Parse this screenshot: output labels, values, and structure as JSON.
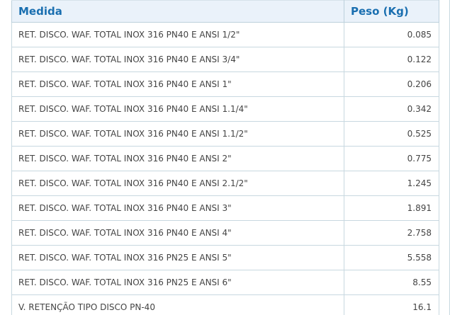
{
  "table": {
    "headers": {
      "medida": "Medida",
      "peso": "Peso (Kg)"
    },
    "rows": [
      {
        "medida": "RET. DISCO. WAF. TOTAL INOX 316 PN40 E ANSI 1/2\"",
        "peso": "0.085"
      },
      {
        "medida": "RET. DISCO. WAF. TOTAL INOX 316 PN40 E ANSI 3/4\"",
        "peso": "0.122"
      },
      {
        "medida": "RET. DISCO. WAF. TOTAL INOX 316 PN40 E ANSI 1\"",
        "peso": "0.206"
      },
      {
        "medida": "RET. DISCO. WAF. TOTAL INOX 316 PN40 E ANSI 1.1/4\"",
        "peso": "0.342"
      },
      {
        "medida": "RET. DISCO. WAF. TOTAL INOX 316 PN40 E ANSI 1.1/2\"",
        "peso": "0.525"
      },
      {
        "medida": "RET. DISCO. WAF. TOTAL INOX 316 PN40 E ANSI 2\"",
        "peso": "0.775"
      },
      {
        "medida": "RET. DISCO. WAF. TOTAL INOX 316 PN40 E ANSI 2.1/2\"",
        "peso": "1.245"
      },
      {
        "medida": "RET. DISCO. WAF. TOTAL INOX 316 PN40 E ANSI 3\"",
        "peso": "1.891"
      },
      {
        "medida": "RET. DISCO. WAF. TOTAL INOX 316 PN40 E ANSI 4\"",
        "peso": "2.758"
      },
      {
        "medida": "RET. DISCO. WAF. TOTAL INOX 316 PN25 E ANSI 5\"",
        "peso": "5.558"
      },
      {
        "medida": "RET. DISCO. WAF. TOTAL INOX 316 PN25 E ANSI 6\"",
        "peso": "8.55"
      },
      {
        "medida": "V. RETENÇÃO TIPO DISCO PN-40",
        "peso": "16.1"
      }
    ]
  },
  "colors": {
    "header_text": "#1a6fb0",
    "header_bg": "#eaf2fa",
    "border": "#c8d8e0",
    "cell_text": "#444444"
  }
}
